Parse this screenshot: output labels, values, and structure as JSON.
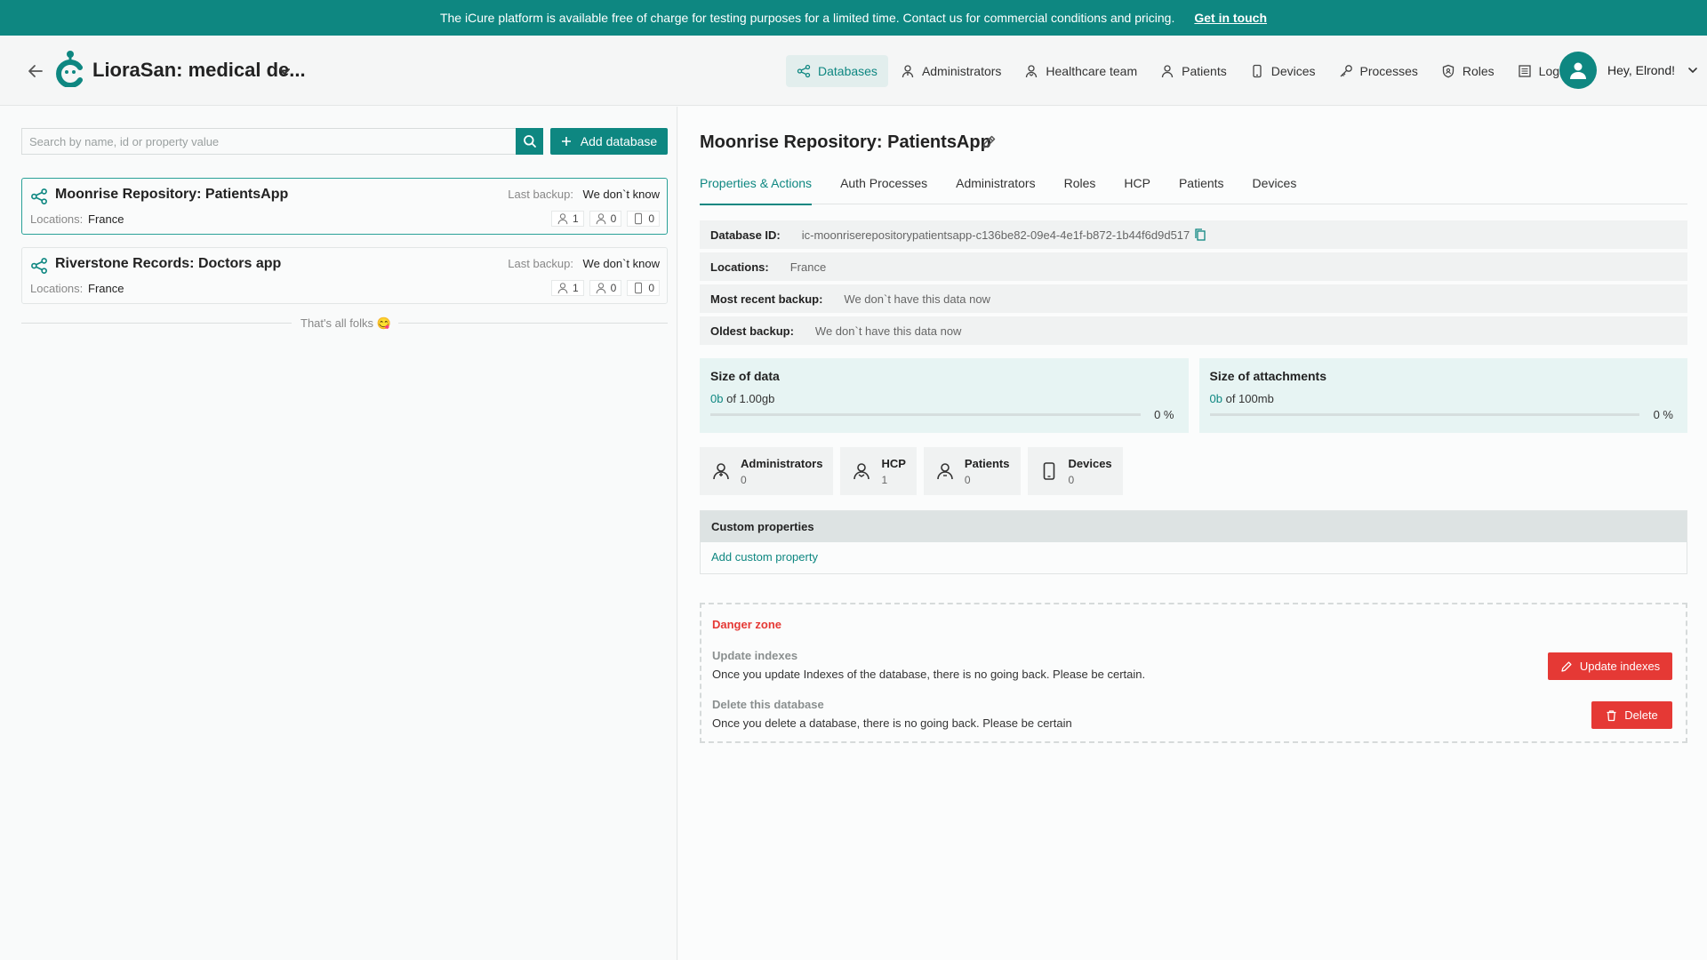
{
  "banner": {
    "text": "The iCure platform is available free of charge for testing purposes for a limited time. Contact us for commercial conditions and pricing.",
    "link": "Get in touch"
  },
  "header": {
    "app_title": "LioraSan: medical de...",
    "nav": [
      {
        "label": "Databases",
        "icon": "databases-icon",
        "active": true
      },
      {
        "label": "Administrators",
        "icon": "administrator-icon"
      },
      {
        "label": "Healthcare team",
        "icon": "healthcare-team-icon"
      },
      {
        "label": "Patients",
        "icon": "patient-icon"
      },
      {
        "label": "Devices",
        "icon": "device-icon"
      },
      {
        "label": "Processes",
        "icon": "processes-icon"
      },
      {
        "label": "Roles",
        "icon": "roles-icon"
      },
      {
        "label": "Logs",
        "icon": "logs-icon"
      }
    ],
    "user_greeting": "Hey, Elrond!"
  },
  "left": {
    "search_placeholder": "Search by name, id or property value",
    "add_database_label": "Add database",
    "databases": [
      {
        "name": "Moonrise Repository: PatientsApp",
        "backup_label": "Last backup:",
        "backup_value": "We don`t know",
        "locations_label": "Locations:",
        "locations_value": "France",
        "count_1": "1",
        "count_2": "0",
        "count_3": "0"
      },
      {
        "name": "Riverstone Records: Doctors app",
        "backup_label": "Last backup:",
        "backup_value": "We don`t know",
        "locations_label": "Locations:",
        "locations_value": "France",
        "count_1": "1",
        "count_2": "0",
        "count_3": "0"
      }
    ],
    "end_of_list": "That's all folks 😋"
  },
  "detail": {
    "title": "Moonrise Repository: PatientsApp",
    "tabs": [
      "Properties & Actions",
      "Auth Processes",
      "Administrators",
      "Roles",
      "HCP",
      "Patients",
      "Devices"
    ],
    "properties": [
      {
        "key": "Database ID:",
        "value": "ic-moonriserepositorypatientsapp-c136be82-09e4-4e1f-b872-1b44f6d9d517"
      },
      {
        "key": "Locations:",
        "value": "France"
      },
      {
        "key": "Most recent backup:",
        "value": "We don`t have this data now"
      },
      {
        "key": "Oldest backup:",
        "value": "We don`t have this data now"
      }
    ],
    "size_data": {
      "title": "Size of data",
      "used": "0b",
      "of_total": "of 1.00gb",
      "percent_label": "0 %",
      "fill_fraction": 0
    },
    "size_attachments": {
      "title": "Size of attachments",
      "used": "0b",
      "of_total": "of 100mb",
      "percent_label": "0 %",
      "fill_fraction": 0
    },
    "stats": [
      {
        "label": "Administrators",
        "value": "0",
        "icon": "administrators-icon"
      },
      {
        "label": "HCP",
        "value": "1",
        "icon": "hcp-icon"
      },
      {
        "label": "Patients",
        "value": "0",
        "icon": "patients-icon"
      },
      {
        "label": "Devices",
        "value": "0",
        "icon": "devices-icon"
      }
    ],
    "custom_properties": {
      "title": "Custom properties",
      "add_link": "Add custom property"
    },
    "danger": {
      "title": "Danger zone",
      "update_title": "Update indexes",
      "update_desc": "Once you update Indexes of the database, there is no going back. Please be certain.",
      "update_button": "Update indexes",
      "delete_title": "Delete this database",
      "delete_desc": "Once you delete a database, there is no going back. Please be certain",
      "delete_button": "Delete"
    }
  },
  "colors": {
    "accent": "#0e8781",
    "danger": "#e53935",
    "banner": "#0e8781"
  }
}
